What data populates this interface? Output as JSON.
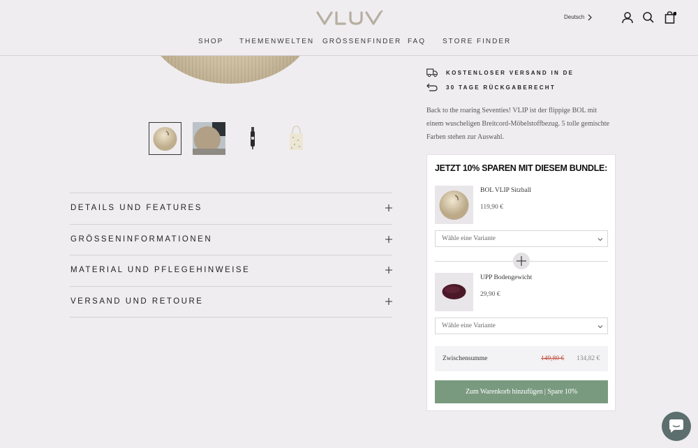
{
  "header": {
    "logo_text": "VLUV",
    "language": "Deutsch",
    "nav": [
      "SHOP",
      "THEMENWELTEN",
      "GRÖSSENFINDER",
      "FAQ",
      "STORE FINDER"
    ],
    "icons": [
      "account-icon",
      "search-icon",
      "cart-icon"
    ]
  },
  "gallery": {
    "thumbnails": [
      "ball-thumbnail",
      "ball-room-thumbnail",
      "pump-thumbnail",
      "tote-bag-thumbnail"
    ]
  },
  "accordion": [
    "DETAILS UND FEATURES",
    "GRÖSSENINFORMATIONEN",
    "MATERIAL UND PFLEGEHINWEISE",
    "VERSAND UND RETOURE"
  ],
  "info": {
    "shipping": "KOSTENLOSER VERSAND IN DE",
    "returns": "30 TAGE RÜCKGABERECHT"
  },
  "description": "Back to the roaring Seventies! VLIP ist der flippige BOL mit einem wuscheligen Breitcord-Möbelstoffbezug. 5 tolle gemischte Farben stehen zur Auswahl.",
  "bundle": {
    "title": "JETZT 10% SPAREN MIT DIESEM BUNDLE:",
    "products": [
      {
        "name": "BOL VLIP Sitzball",
        "price": "119,90 €",
        "variant_placeholder": "Wähle eine Variante"
      },
      {
        "name": "UPP Bodengewicht",
        "price": "29,90 €",
        "variant_placeholder": "Wähle eine Variante"
      }
    ],
    "subtotal_label": "Zwischensumme",
    "subtotal_old": "149,80 €",
    "subtotal_new": "134,82 €",
    "cta": "Zum Warenkorb hinzufügen | Spare 10%"
  },
  "colors": {
    "background": "#efedf0",
    "cta": "#7a9a80",
    "strike_price": "#c24d3c",
    "chat_button": "#5c6e6d"
  }
}
